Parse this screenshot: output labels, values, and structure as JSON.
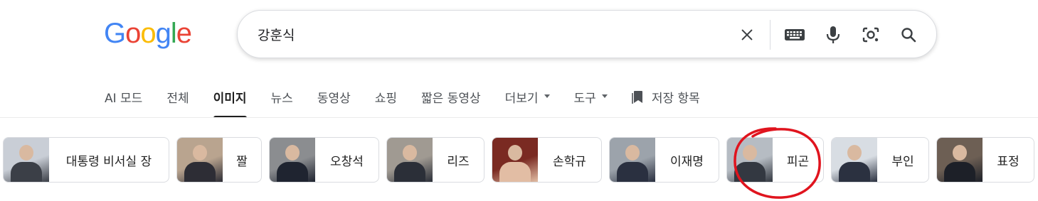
{
  "logo": {
    "letters": [
      "G",
      "o",
      "o",
      "g",
      "l",
      "e"
    ],
    "colors": [
      "#4285f4",
      "#ea4335",
      "#fbbc05",
      "#4285f4",
      "#34a853",
      "#ea4335"
    ]
  },
  "search": {
    "query": "강훈식"
  },
  "search_icons": [
    "clear-icon",
    "keyboard-icon",
    "microphone-icon",
    "camera-lens-icon",
    "search-icon"
  ],
  "tabs": [
    {
      "label": "AI 모드",
      "active": false
    },
    {
      "label": "전체",
      "active": false
    },
    {
      "label": "이미지",
      "active": true
    },
    {
      "label": "뉴스",
      "active": false
    },
    {
      "label": "동영상",
      "active": false
    },
    {
      "label": "쇼핑",
      "active": false
    },
    {
      "label": "짧은 동영상",
      "active": false
    },
    {
      "label": "더보기",
      "active": false,
      "dropdown": true
    },
    {
      "label": "도구",
      "active": false,
      "dropdown": true
    },
    {
      "label": "저장 항목",
      "active": false,
      "icon": "bookmark-icon"
    }
  ],
  "chips": [
    {
      "label": "대통령 비서실 장",
      "thumb_colors": [
        "#c9ced6",
        "#3b3f47"
      ]
    },
    {
      "label": "짤",
      "thumb_colors": [
        "#b9a48f",
        "#2d2d35"
      ]
    },
    {
      "label": "오창석",
      "thumb_colors": [
        "#8b8d90",
        "#1f2430"
      ]
    },
    {
      "label": "리즈",
      "thumb_colors": [
        "#a09a92",
        "#2b2f38"
      ]
    },
    {
      "label": "손학규",
      "thumb_colors": [
        "#7a2a22",
        "#e2bda4"
      ]
    },
    {
      "label": "이재명",
      "thumb_colors": [
        "#9ca3ab",
        "#2a3040"
      ]
    },
    {
      "label": "피곤",
      "thumb_colors": [
        "#b6bcc3",
        "#333841"
      ]
    },
    {
      "label": "부인",
      "thumb_colors": [
        "#d8dde3",
        "#2b3140"
      ]
    },
    {
      "label": "표정",
      "thumb_colors": [
        "#6d5f54",
        "#1d2028"
      ]
    }
  ],
  "annotation": {
    "color": "#e0141e"
  }
}
